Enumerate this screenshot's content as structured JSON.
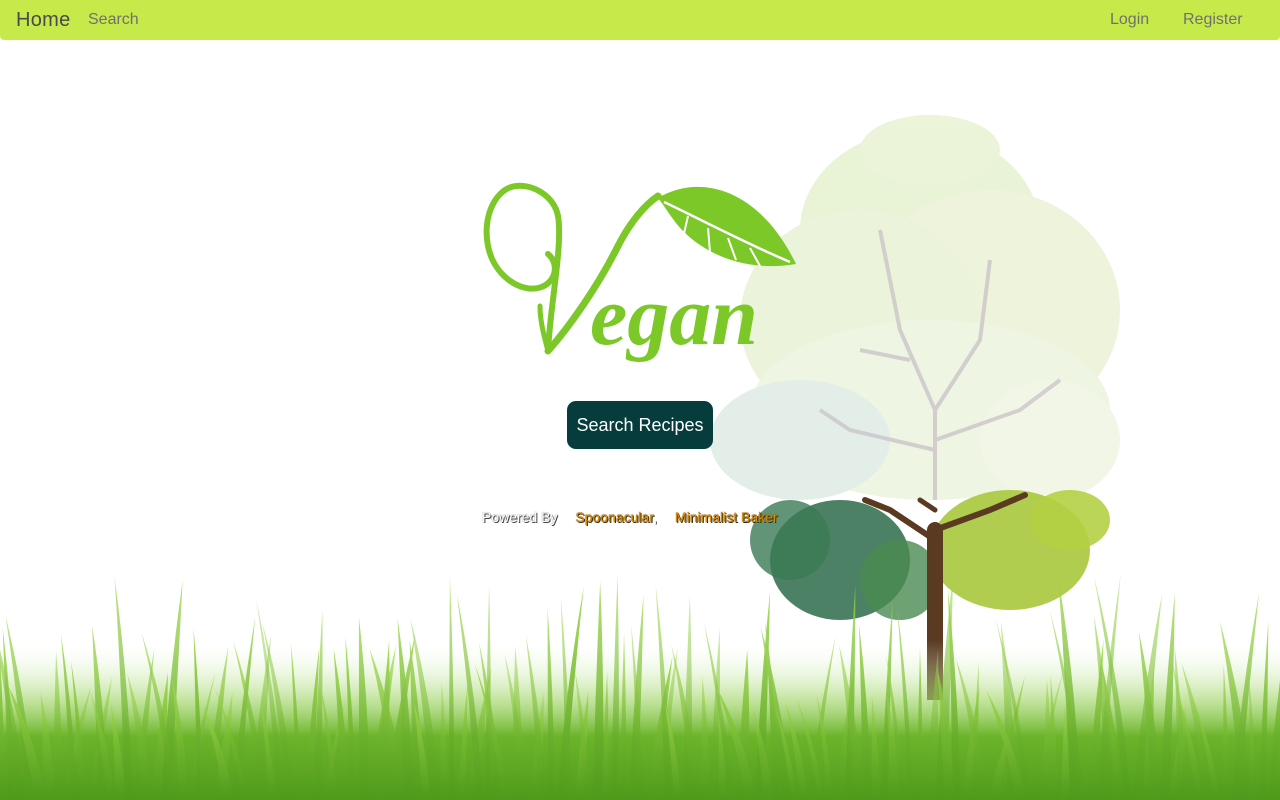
{
  "nav": {
    "home": "Home",
    "search": "Search",
    "login": "Login",
    "register": "Register"
  },
  "hero": {
    "logo_text": "Vegan",
    "search_button": "Search Recipes"
  },
  "footer": {
    "powered_by": "Powered By",
    "source_1": "Spoonacular",
    "separator": ",",
    "source_2": "Minimalist Baker"
  },
  "colors": {
    "navbar": "#c6ea4a",
    "logo_green": "#7bc828",
    "button_bg": "#063d3c",
    "link_orange": "#e08a00",
    "grass": "#6cb52a"
  },
  "icons": {
    "logo_leaf": "leaf-icon"
  }
}
